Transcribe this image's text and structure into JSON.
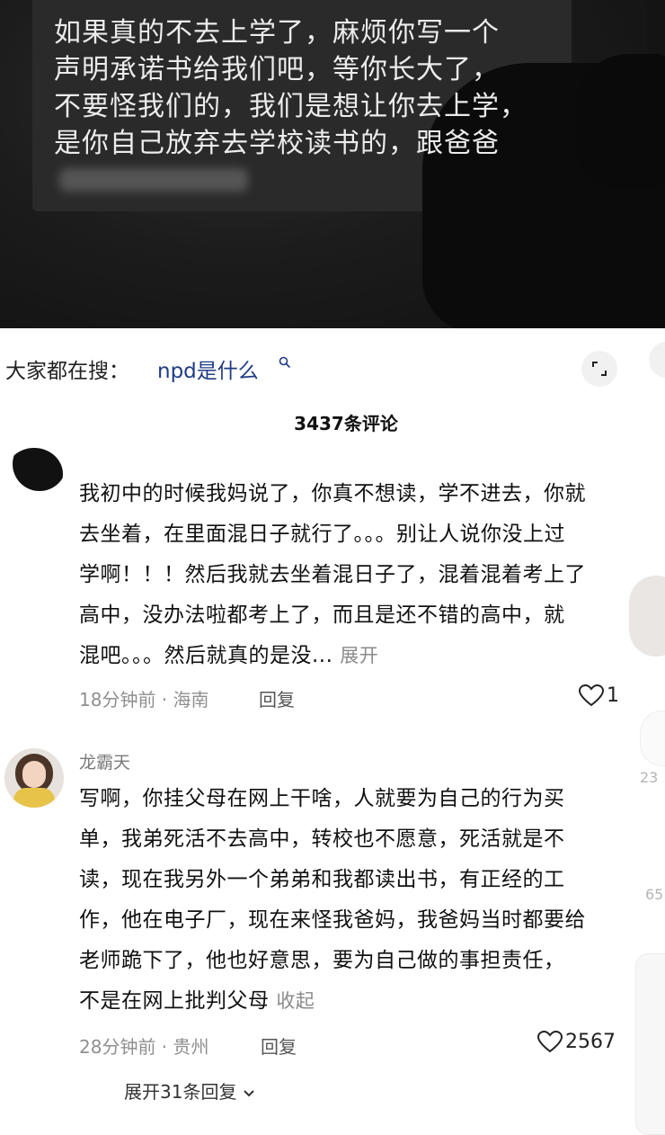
{
  "video": {
    "caption_lines": [
      "如果真的不去上学了，麻烦你写一个",
      "声明承诺书给我们吧，等你长大了，",
      "不要怪我们的，我们是想让你去上学，",
      "是你自己放弃去学校读书的，跟爸爸"
    ]
  },
  "search_suggestion": {
    "prefix": "大家都在搜：",
    "term": "npd是什么",
    "icon": "search-icon"
  },
  "comments_header": {
    "count_label": "3437条评论"
  },
  "comments": [
    {
      "username": "",
      "body_lines": [
        "我初中的时候我妈说了，你真不想读，学不进去，你就",
        "去坐着，在里面混日子就行了。。。别让人说你没上过",
        "学啊！！！然后我就去坐着混日子了，混着混着考上了",
        "高中，没办法啦都考上了，而且是还不错的高中，就",
        "混吧。。。然后就真的是没..."
      ],
      "expand_label": "展开",
      "meta": "18分钟前 · 海南",
      "reply_label": "回复",
      "likes": "1"
    },
    {
      "username": "龙霸天",
      "body_lines": [
        "写啊，你挂父母在网上干啥，人就要为自己的行为买",
        "单，我弟死活不去高中，转校也不愿意，死活就是不",
        "读，现在我另外一个弟弟和我都读出书，有正经的工",
        "作，他在电子厂，现在来怪我爸妈，我爸妈当时都要给",
        "老师跪下了，他也好意思，要为自己做的事担责任，",
        "不是在网上批判父母"
      ],
      "collapse_label": "收起",
      "meta": "28分钟前 · 贵州",
      "reply_label": "回复",
      "likes": "2567",
      "expand_replies_label": "展开31条回复"
    }
  ],
  "edge_numbers": [
    "23",
    "65"
  ],
  "colors": {
    "search_term": "#1f3b86",
    "meta_gray": "#8f8f8f",
    "video_bg": "#141414"
  }
}
